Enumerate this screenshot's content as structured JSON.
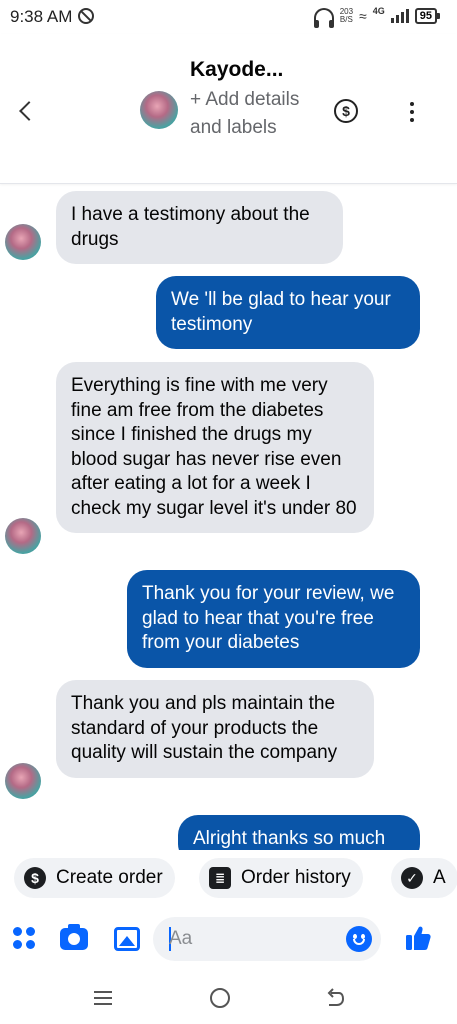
{
  "status_bar": {
    "time": "9:38 AM",
    "net_speed_value": "203",
    "net_speed_unit": "B/S",
    "network_type": "4G",
    "battery": "95"
  },
  "header": {
    "contact_name": "Kayode...",
    "subtitle": "+ Add details and labels",
    "dollar_symbol": "$"
  },
  "messages": [
    {
      "direction": "in",
      "text": "I have a testimony about the drugs"
    },
    {
      "direction": "out",
      "text": "We 'll be glad to hear your testimony"
    },
    {
      "direction": "in",
      "text": "Everything is fine with me very fine am free from the diabetes since I finished the drugs my blood sugar has never rise even after eating a lot for a week I check my sugar level it's under 80"
    },
    {
      "direction": "out",
      "text": "Thank you for your review, we glad to hear that you're free from your diabetes"
    },
    {
      "direction": "in",
      "text": "Thank you and pls maintain the standard of your products the quality will sustain the company"
    },
    {
      "direction": "out",
      "text": "Alright thanks so much"
    }
  ],
  "quick_actions": [
    {
      "label": "Create order",
      "icon": "dollar-circle-icon",
      "glyph": "$"
    },
    {
      "label": "Order history",
      "icon": "receipt-list-icon",
      "glyph": "≣"
    },
    {
      "label": "A",
      "icon": "check-circle-icon",
      "glyph": "✓"
    }
  ],
  "composer": {
    "placeholder": "Aa"
  },
  "colors": {
    "outgoing_bubble": "#0a55a8",
    "incoming_bubble": "#e4e6eb",
    "accent": "#0866ff"
  }
}
